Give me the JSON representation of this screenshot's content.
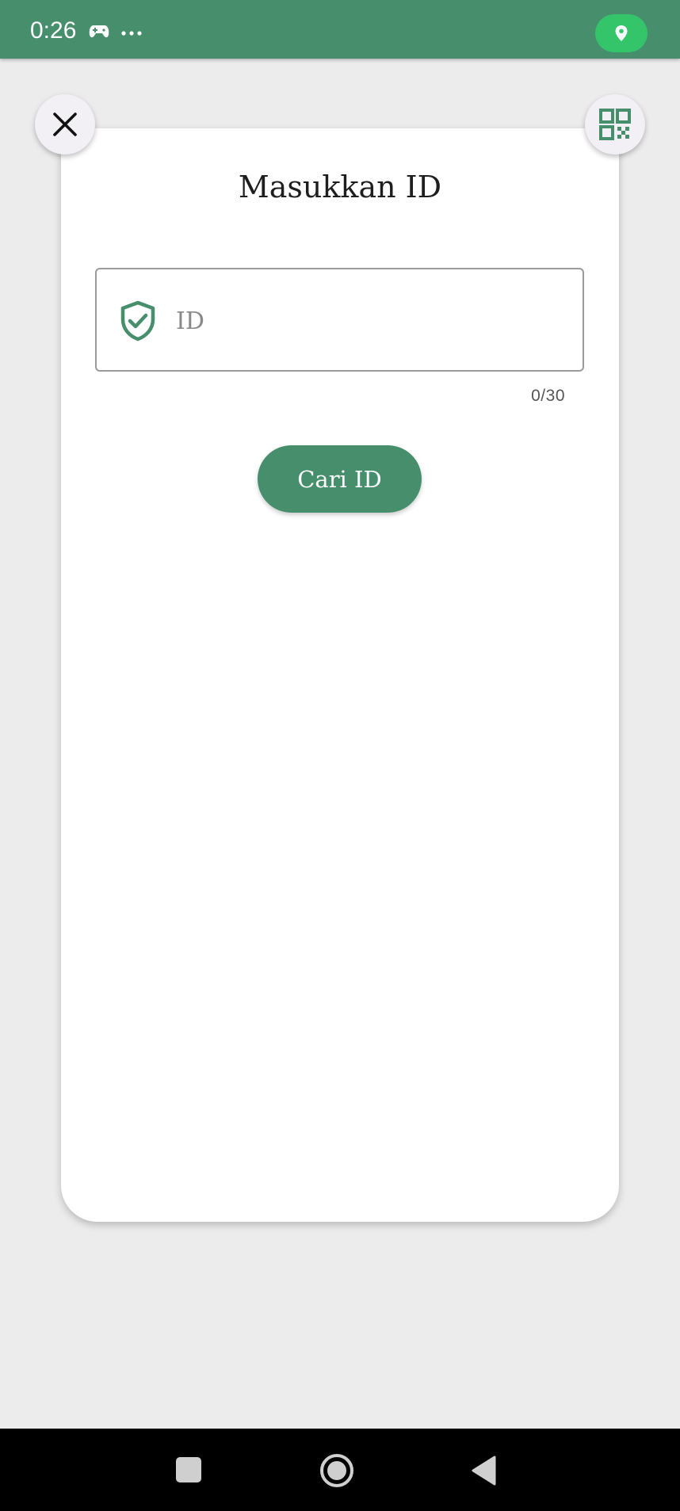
{
  "status_bar": {
    "time": "0:26",
    "icons": [
      "gamepad-icon",
      "more-icon",
      "location-icon"
    ],
    "background_color": "#478e6d",
    "location_pill_color": "#34c46a"
  },
  "dialog": {
    "title": "Masukkan ID",
    "input": {
      "placeholder": "ID",
      "value": "",
      "counter": "0/30",
      "icon": "shield-check-icon"
    },
    "search_button_label": "Cari ID",
    "accent_color": "#478e6d"
  },
  "fabs": {
    "close_icon": "close-icon",
    "qr_icon": "qr-code-icon"
  },
  "nav_bar": {
    "buttons": [
      "recents-button",
      "home-button",
      "back-button"
    ]
  }
}
